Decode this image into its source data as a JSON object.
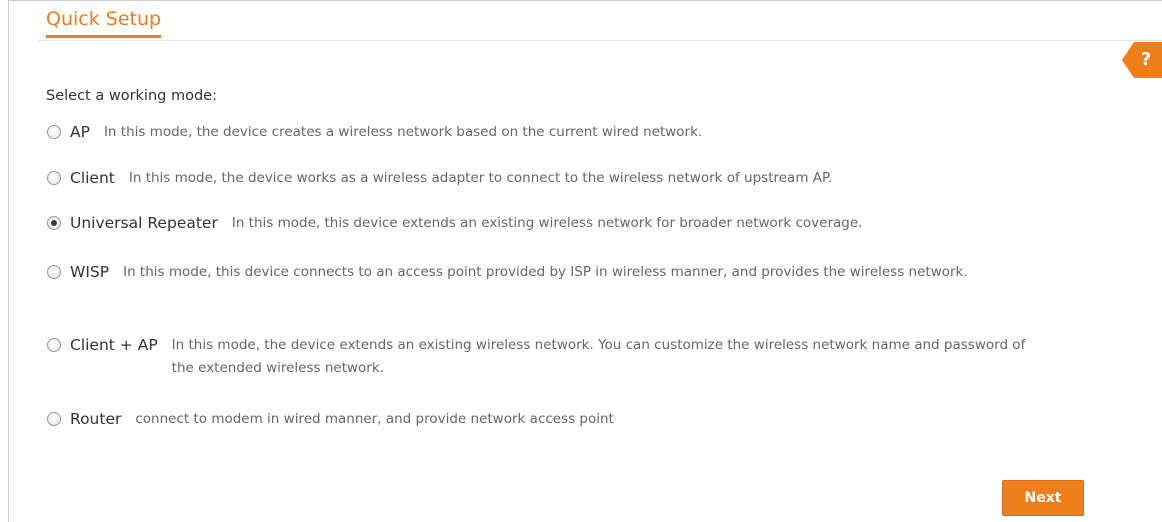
{
  "header": {
    "title": "Quick Setup",
    "help_label": "?"
  },
  "prompt": "Select a working mode:",
  "modes": [
    {
      "name": "AP",
      "description": "In this mode, the device creates a wireless network based on the current wired network.",
      "selected": false
    },
    {
      "name": "Client",
      "description": "In this mode, the device works as a wireless adapter to connect to the wireless network of upstream AP.",
      "selected": false
    },
    {
      "name": "Universal Repeater",
      "description": "In this mode, this device extends an existing wireless network for broader network coverage.",
      "selected": true
    },
    {
      "name": "WISP",
      "description": "In this mode, this device connects to an access point provided by ISP in wireless manner, and provides the wireless network.",
      "selected": false
    },
    {
      "name": "Client + AP",
      "description": "In this mode, the device extends an existing wireless network. You can customize the wireless network name and password of the extended wireless network.",
      "selected": false
    },
    {
      "name": "Router",
      "description": "connect to modem in wired manner, and provide network access point",
      "selected": false
    }
  ],
  "footer": {
    "next_label": "Next"
  },
  "colors": {
    "accent": "#ef7f1a",
    "title": "#f07c1f"
  }
}
